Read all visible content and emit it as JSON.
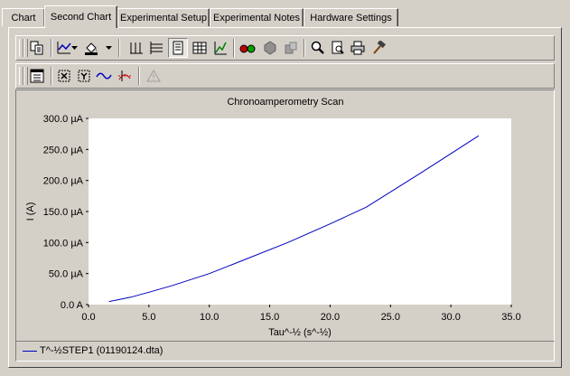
{
  "tabs": [
    {
      "label": "Chart",
      "active": false
    },
    {
      "label": "Second Chart",
      "active": true
    },
    {
      "label": "Experimental Setup",
      "active": false
    },
    {
      "label": "Experimental Notes",
      "active": false
    },
    {
      "label": "Hardware Settings",
      "active": false
    }
  ],
  "toolbar1": {
    "icons": [
      "copy-icon",
      "line-style-icon",
      "dropdown-arrow-icon",
      "fill-color-icon",
      "dropdown-arrow-icon",
      "vertical-grid-icon",
      "horizontal-grid-icon",
      "page-layout-icon",
      "table-grid-icon",
      "log-scale-icon",
      "glasses-icon",
      "color-wheel-icon",
      "palette-icon",
      "zoom-icon",
      "print-preview-icon",
      "printer-icon",
      "hammer-icon"
    ]
  },
  "toolbar2": {
    "icons": [
      "data-table-icon",
      "x-axis-icon",
      "y-axis-icon",
      "wave-icon",
      "cursor-icon",
      "warning-icon"
    ]
  },
  "colors": {
    "series": "#0000c0",
    "background": "#d4d0c8",
    "plot_bg": "#ffffff"
  },
  "chart_data": {
    "type": "line",
    "title": "Chronoamperometry Scan",
    "xlabel": "Tau^-½ (s^-½)",
    "ylabel": "I (A)",
    "xlim": [
      0,
      35
    ],
    "ylim": [
      0,
      300
    ],
    "x_ticks": [
      "0.0",
      "5.0",
      "10.0",
      "15.0",
      "20.0",
      "25.0",
      "30.0",
      "35.0"
    ],
    "y_ticks": [
      "0.0 A",
      "50.0 µA",
      "100.0 µA",
      "150.0 µA",
      "200.0 µA",
      "250.0 µA",
      "300.0 µA"
    ],
    "series": [
      {
        "name": "T^-½STEP1 (01190124.dta)",
        "x": [
          1.7,
          2.5,
          3.5,
          5.0,
          7.0,
          10.0,
          13.0,
          16.5,
          20.0,
          23.0,
          27.5,
          32.3
        ],
        "y": [
          5,
          8,
          12,
          20,
          31,
          50,
          73,
          100,
          130,
          157,
          212,
          272
        ]
      }
    ],
    "legend": "bottom",
    "grid": false
  }
}
